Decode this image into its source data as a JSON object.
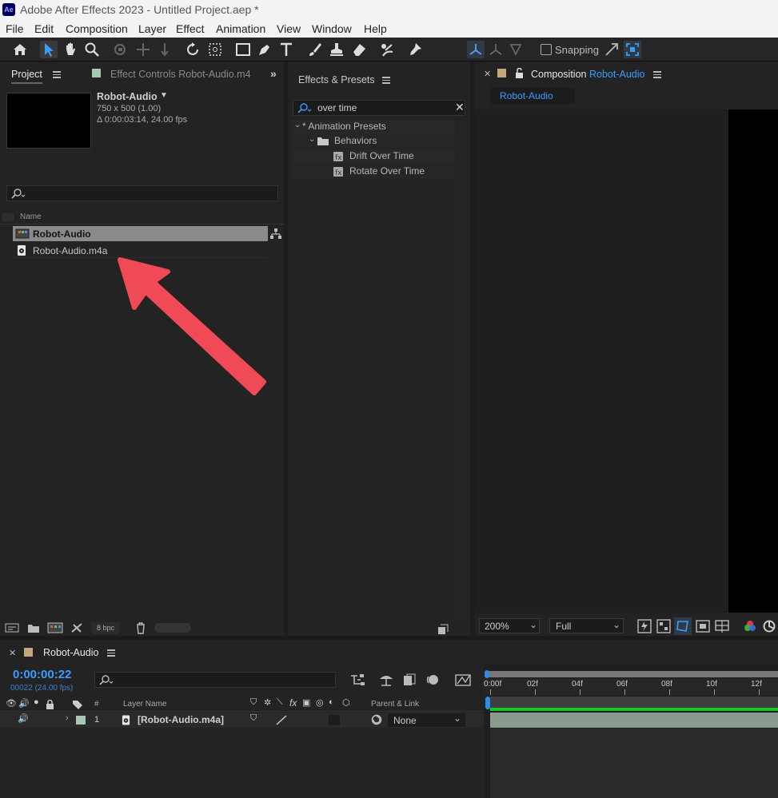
{
  "app": {
    "logo_text": "Ae",
    "window_title": "Adobe After Effects 2023 - Untitled Project.aep *"
  },
  "menu": [
    "File",
    "Edit",
    "Composition",
    "Layer",
    "Effect",
    "Animation",
    "View",
    "Window",
    "Help"
  ],
  "toolbar": {
    "snapping_label": "Snapping",
    "icons": [
      "home-icon",
      "selection-arrow-icon",
      "hand-icon",
      "zoom-icon",
      "orbit-camera-icon",
      "pan-camera-icon",
      "dolly-camera-icon",
      "rotate-icon",
      "anchor-point-icon",
      "rectangle-icon",
      "pen-icon",
      "type-icon",
      "brush-icon",
      "clone-stamp-icon",
      "eraser-icon",
      "roto-brush-icon",
      "puppet-pin-icon"
    ]
  },
  "project_panel": {
    "tab_label": "Project",
    "effect_controls_tab": "Effect Controls Robot-Audio.m4",
    "selected_item": {
      "name": "Robot-Audio",
      "dimensions": "750 x 500 (1.00)",
      "duration": "Δ 0:00:03:14, 24.00 fps"
    },
    "search_placeholder": "",
    "column_name": "Name",
    "items": [
      {
        "name": "Robot-Audio",
        "type": "composition",
        "selected": true
      },
      {
        "name": "Robot-Audio.m4a",
        "type": "audio",
        "selected": false
      }
    ],
    "footer_bpc": "8 bpc"
  },
  "effects_panel": {
    "tab_label": "Effects & Presets",
    "search_value": "over time",
    "tree": [
      {
        "label": "* Animation Presets",
        "level": 0
      },
      {
        "label": "Behaviors",
        "level": 1
      },
      {
        "label": "Drift Over Time",
        "level": 2
      },
      {
        "label": "Rotate Over Time",
        "level": 2
      }
    ]
  },
  "composition_panel": {
    "tab_prefix": "Composition",
    "tab_name": "Robot-Audio",
    "sub_tab": "Robot-Audio",
    "zoom": "200%",
    "resolution": "Full"
  },
  "timeline": {
    "tab_label": "Robot-Audio",
    "timecode": "0:00:00:22",
    "frame_info": "00022 (24.00 fps)",
    "columns": {
      "number": "#",
      "layer_name": "Layer Name",
      "parent": "Parent & Link"
    },
    "ruler": [
      "0:00f",
      "02f",
      "04f",
      "06f",
      "08f",
      "10f",
      "12f"
    ],
    "layers": [
      {
        "number": "1",
        "name": "[Robot-Audio.m4a]",
        "parent": "None",
        "label_color": "#a9c6b3"
      }
    ]
  },
  "colors": {
    "accent_blue": "#2d8ceb",
    "annotation_arrow": "#f04a56",
    "selection_gray": "#8a8a8a",
    "work_area_green": "#19c62a"
  }
}
